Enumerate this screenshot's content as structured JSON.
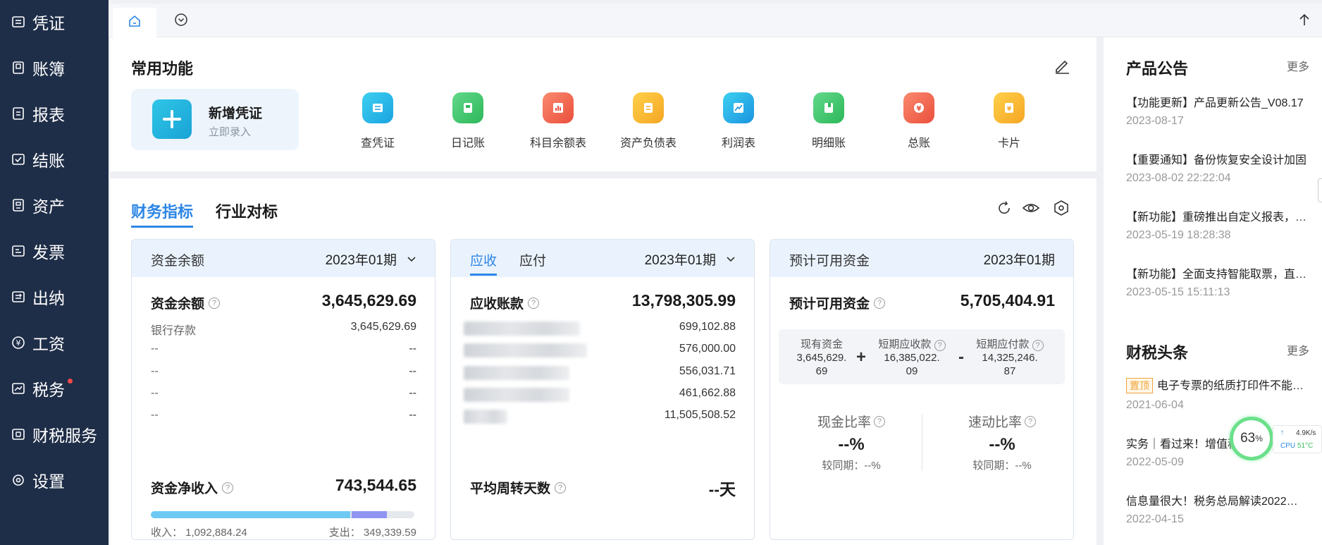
{
  "sidebar": {
    "items": [
      {
        "label": "凭证",
        "icon": "voucher-icon"
      },
      {
        "label": "账簿",
        "icon": "ledger-book-icon"
      },
      {
        "label": "报表",
        "icon": "report-icon"
      },
      {
        "label": "结账",
        "icon": "checkout-icon"
      },
      {
        "label": "资产",
        "icon": "asset-icon"
      },
      {
        "label": "发票",
        "icon": "invoice-icon"
      },
      {
        "label": "出纳",
        "icon": "cashier-icon"
      },
      {
        "label": "工资",
        "icon": "yuan-icon"
      },
      {
        "label": "税务",
        "icon": "tax-icon"
      },
      {
        "label": "财税服务",
        "icon": "service-icon"
      },
      {
        "label": "设置",
        "icon": "gear-icon"
      }
    ]
  },
  "common": {
    "title": "常用功能",
    "new_voucher": {
      "title": "新增凭证",
      "subtitle": "立即录入"
    },
    "functions": [
      {
        "label": "查凭证",
        "icon": "list-icon",
        "color": "#25b9e8"
      },
      {
        "label": "日记账",
        "icon": "notebook-icon",
        "color": "#3cc46a"
      },
      {
        "label": "科目余额表",
        "icon": "bar-chart-icon",
        "color": "#f0674f"
      },
      {
        "label": "资产负债表",
        "icon": "document-icon",
        "color": "#f7b42a"
      },
      {
        "label": "利润表",
        "icon": "trend-icon",
        "color": "#1fb4ea"
      },
      {
        "label": "明细账",
        "icon": "detail-book-icon",
        "color": "#3cc46a"
      },
      {
        "label": "总账",
        "icon": "yuan-circle-icon",
        "color": "#f0674f"
      },
      {
        "label": "卡片",
        "icon": "card-icon",
        "color": "#f7b42a"
      }
    ]
  },
  "fin": {
    "tabs": [
      "财务指标",
      "行业对标"
    ],
    "funds": {
      "title": "资金余额",
      "period": "2023年01期",
      "label": "资金余额",
      "value": "3,645,629.69",
      "rows": [
        {
          "label": "银行存款",
          "value": "3,645,629.69"
        },
        {
          "label": "--",
          "value": "--"
        },
        {
          "label": "--",
          "value": "--"
        },
        {
          "label": "--",
          "value": "--"
        },
        {
          "label": "--",
          "value": "--"
        }
      ],
      "net_label": "资金净收入",
      "net_value": "743,544.65",
      "income": "收入：  1,092,884.24",
      "expense": "支出：  349,339.59",
      "income_amount": 1092884.24,
      "expense_amount": 349339.59
    },
    "receivable": {
      "tab_active": "应收",
      "tab_other": "应付",
      "period": "2023年01期",
      "label": "应收账款",
      "value": "13,798,305.99",
      "rows": [
        "699,102.88",
        "576,000.00",
        "556,031.71",
        "461,662.88",
        "11,505,508.52"
      ],
      "turnover_label": "平均周转天数",
      "turnover_value": "--天"
    },
    "available": {
      "title": "预计可用资金",
      "period": "2023年01期",
      "label": "预计可用资金",
      "value": "5,705,404.91",
      "cash_label": "现有资金",
      "cash_l1": "3,645,629.",
      "cash_l2": "69",
      "plus": "+",
      "recv_label": "短期应收款",
      "recv_l1": "16,385,022.",
      "recv_l2": "09",
      "minus": "-",
      "pay_label": "短期应付款",
      "pay_l1": "14,325,246.",
      "pay_l2": "87",
      "ratio1_label": "现金比率",
      "ratio1_value": "--%",
      "ratio1_compare": "较同期：--%",
      "ratio2_label": "速动比率",
      "ratio2_value": "--%",
      "ratio2_compare": "较同期：--%"
    }
  },
  "announcements": {
    "title": "产品公告",
    "more": "更多",
    "items": [
      {
        "title": "【功能更新】产品更新公告_V08.17",
        "date": "2023-08-17"
      },
      {
        "title": "【重要通知】备份恢复安全设计加固",
        "date": "2023-08-02 22:22:04"
      },
      {
        "title": "【新功能】重磅推出自定义报表，…",
        "date": "2023-05-19 18:28:38"
      },
      {
        "title": "【新功能】全面支持智能取票，直…",
        "date": "2023-05-15 15:11:13"
      }
    ]
  },
  "tax_news": {
    "title": "财税头条",
    "more": "更多",
    "badge": "置顶",
    "items": [
      {
        "title": "电子专票的纸质打印件不能…",
        "date": "2021-06-04"
      },
      {
        "title": "实务｜看过来！增值税",
        "date": "2022-05-09"
      },
      {
        "title": "信息量很大！税务总局解读2022…",
        "date": "2022-04-15"
      }
    ]
  },
  "monitor": {
    "percent": "63",
    "pct_sign": "%",
    "speed": "4.9K/s",
    "cpu": "CPU",
    "temp": "51°C"
  }
}
